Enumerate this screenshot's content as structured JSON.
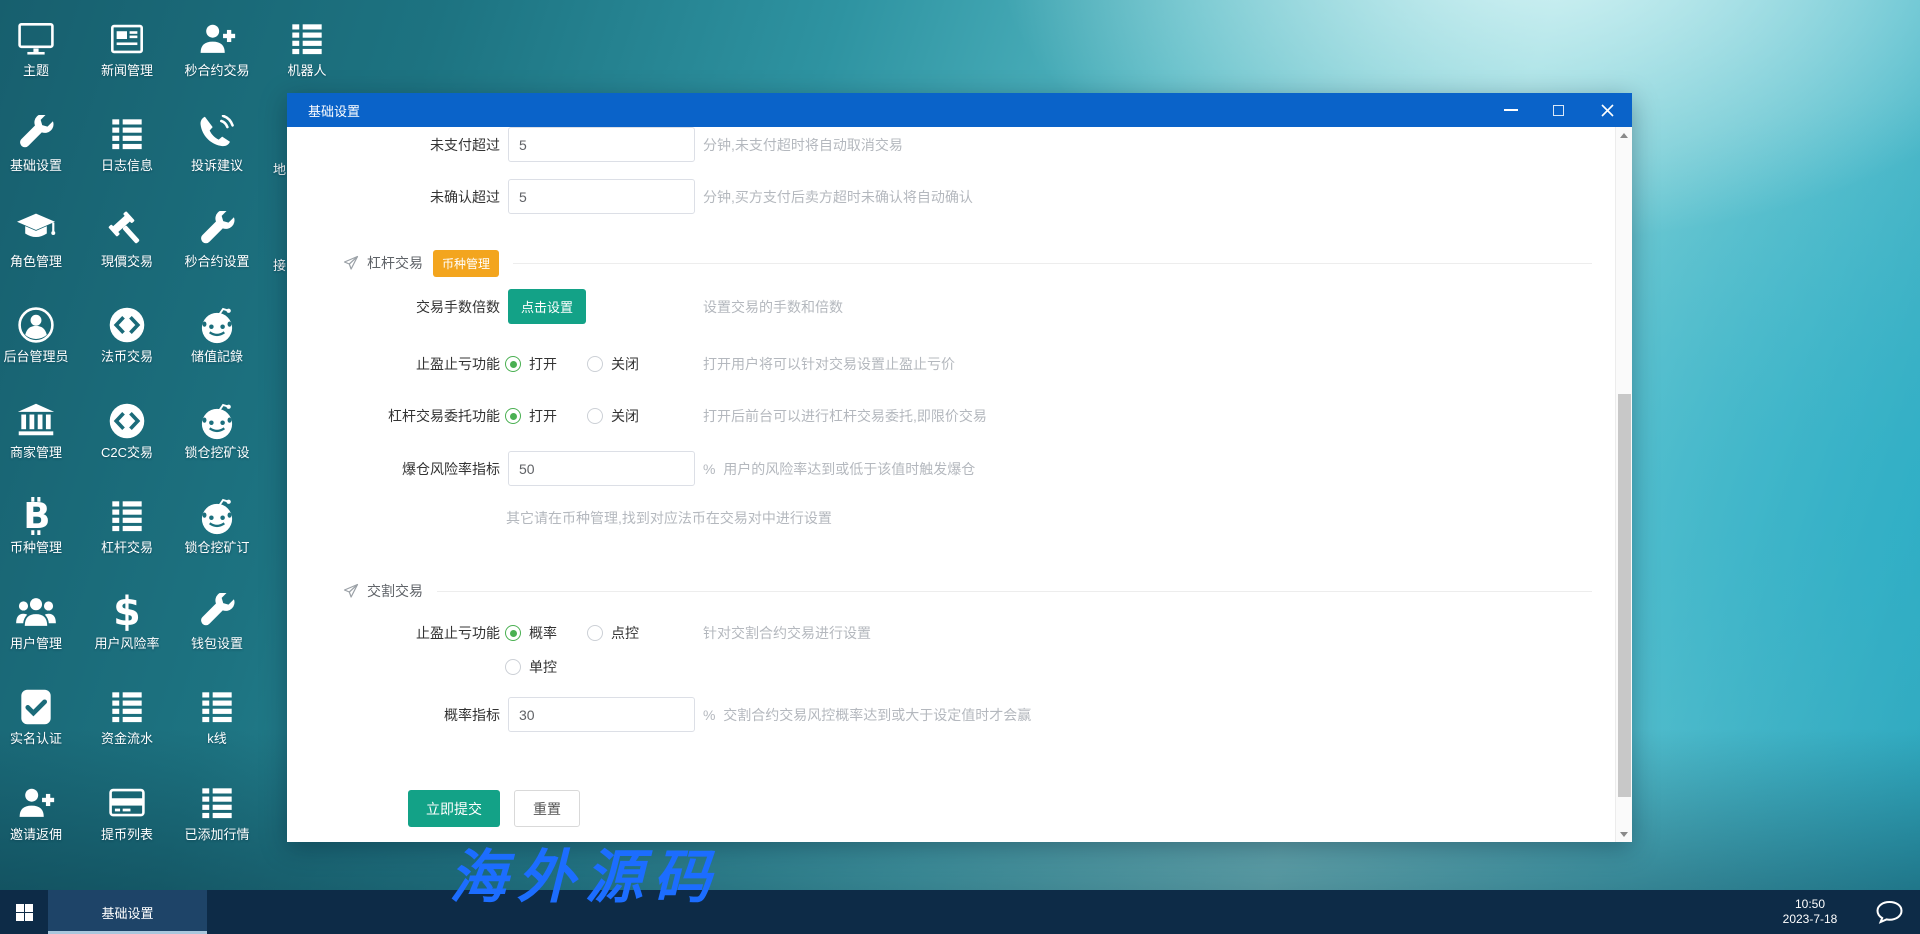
{
  "desktop": {
    "icons": [
      {
        "label": "主题",
        "icon": "monitor",
        "col": 0,
        "row": 0
      },
      {
        "label": "新闻管理",
        "icon": "newspaper",
        "col": 1,
        "row": 0
      },
      {
        "label": "秒合约交易",
        "icon": "user-add",
        "col": 2,
        "row": 0
      },
      {
        "label": "机器人",
        "icon": "list",
        "col": 3,
        "row": 0
      },
      {
        "label": "基础设置",
        "icon": "wrench",
        "col": 0,
        "row": 1
      },
      {
        "label": "日志信息",
        "icon": "list",
        "col": 1,
        "row": 1
      },
      {
        "label": "投诉建议",
        "icon": "phone",
        "col": 2,
        "row": 1
      },
      {
        "label": "角色管理",
        "icon": "graduation-cap",
        "col": 0,
        "row": 2
      },
      {
        "label": "現價交易",
        "icon": "gavel",
        "col": 1,
        "row": 2
      },
      {
        "label": "秒合约设置",
        "icon": "wrench",
        "col": 2,
        "row": 2
      },
      {
        "label": "后台管理员",
        "icon": "user-circle",
        "col": 0,
        "row": 3
      },
      {
        "label": "法币交易",
        "icon": "link-circle",
        "col": 1,
        "row": 3
      },
      {
        "label": "储值記錄",
        "icon": "reddit",
        "col": 2,
        "row": 3
      },
      {
        "label": "商家管理",
        "icon": "bank",
        "col": 0,
        "row": 4
      },
      {
        "label": "C2C交易",
        "icon": "link-circle",
        "col": 1,
        "row": 4
      },
      {
        "label": "锁仓挖矿设",
        "icon": "reddit",
        "col": 2,
        "row": 4
      },
      {
        "label": "币种管理",
        "icon": "bitcoin",
        "col": 0,
        "row": 5
      },
      {
        "label": "杠杆交易",
        "icon": "list",
        "col": 1,
        "row": 5
      },
      {
        "label": "锁仓挖矿订",
        "icon": "reddit",
        "col": 2,
        "row": 5
      },
      {
        "label": "用户管理",
        "icon": "users",
        "col": 0,
        "row": 6
      },
      {
        "label": "用户风险率",
        "icon": "dollar",
        "col": 1,
        "row": 6
      },
      {
        "label": "钱包设置",
        "icon": "wrench",
        "col": 2,
        "row": 6
      },
      {
        "label": "实名认证",
        "icon": "check-square",
        "col": 0,
        "row": 7
      },
      {
        "label": "资金流水",
        "icon": "list",
        "col": 1,
        "row": 7
      },
      {
        "label": "k线",
        "icon": "list",
        "col": 2,
        "row": 7
      },
      {
        "label": "邀请返佣",
        "icon": "user-add",
        "col": 0,
        "row": 8
      },
      {
        "label": "提币列表",
        "icon": "credit-card",
        "col": 1,
        "row": 8
      },
      {
        "label": "已添加行情",
        "icon": "list",
        "col": 2,
        "row": 8
      }
    ],
    "partial_labels": [
      {
        "text": "地",
        "col": 3,
        "row": 1
      },
      {
        "text": "接",
        "col": 3,
        "row": 2
      }
    ]
  },
  "dialog": {
    "title": "基础设置",
    "form": {
      "rows": [
        {
          "kind": "input",
          "name": "unpaid-timeout",
          "label": "未支付超过",
          "value": "5",
          "helper": "分钟,未支付超时将自动取消交易"
        },
        {
          "kind": "input",
          "name": "unconfirmed-timeout",
          "label": "未确认超过",
          "value": "5",
          "helper": "分钟,买方支付后卖方超时未确认将自动确认"
        },
        {
          "kind": "section",
          "name": "leverage-section",
          "label": "杠杆交易",
          "tag": "币种管理"
        },
        {
          "kind": "action",
          "name": "lots-multiplier",
          "label": "交易手数倍数",
          "button": "点击设置",
          "helper": "设置交易的手数和倍数"
        },
        {
          "kind": "radio",
          "name": "stop-profit-loss",
          "label": "止盈止亏功能",
          "options": [
            {
              "label": "打开",
              "checked": true
            },
            {
              "label": "关闭",
              "checked": false
            }
          ],
          "helper": "打开用户将可以针对交易设置止盈止亏价"
        },
        {
          "kind": "radio",
          "name": "leverage-entrust",
          "label": "杠杆交易委托功能",
          "options": [
            {
              "label": "打开",
              "checked": true
            },
            {
              "label": "关闭",
              "checked": false
            }
          ],
          "helper": "打开后前台可以进行杠杆交易委托,即限价交易"
        },
        {
          "kind": "input",
          "name": "liquidation-risk-rate",
          "label": "爆仓风险率指标",
          "value": "50",
          "helper": "%  用户的风险率达到或低于该值时触发爆仓"
        },
        {
          "kind": "note",
          "name": "leverage-note",
          "text": "其它请在币种管理,找到对应法币在交易对中进行设置"
        },
        {
          "kind": "section",
          "name": "delivery-section",
          "label": "交割交易"
        },
        {
          "kind": "radio",
          "name": "delivery-stop-profit-loss",
          "label": "止盈止亏功能",
          "options": [
            {
              "label": "概率",
              "checked": true
            },
            {
              "label": "点控",
              "checked": false
            }
          ],
          "options2": [
            {
              "label": "单控",
              "checked": false
            }
          ],
          "helper": "针对交割合约交易进行设置"
        },
        {
          "kind": "input",
          "name": "probability-indicator",
          "label": "概率指标",
          "value": "30",
          "helper": "%  交割合约交易风控概率达到或大于设定值时才会赢"
        },
        {
          "kind": "actions",
          "name": "form-actions",
          "submit": "立即提交",
          "reset": "重置"
        }
      ]
    },
    "colors": {
      "titlebar": "#0a63c9",
      "green": "#13a287",
      "orange": "#f3a51e",
      "radio_on": "#4ab052"
    }
  },
  "taskbar": {
    "task_label": "基础设置",
    "time": "10:50",
    "date": "2023-7-18"
  },
  "watermark": {
    "text": "海外源码"
  }
}
